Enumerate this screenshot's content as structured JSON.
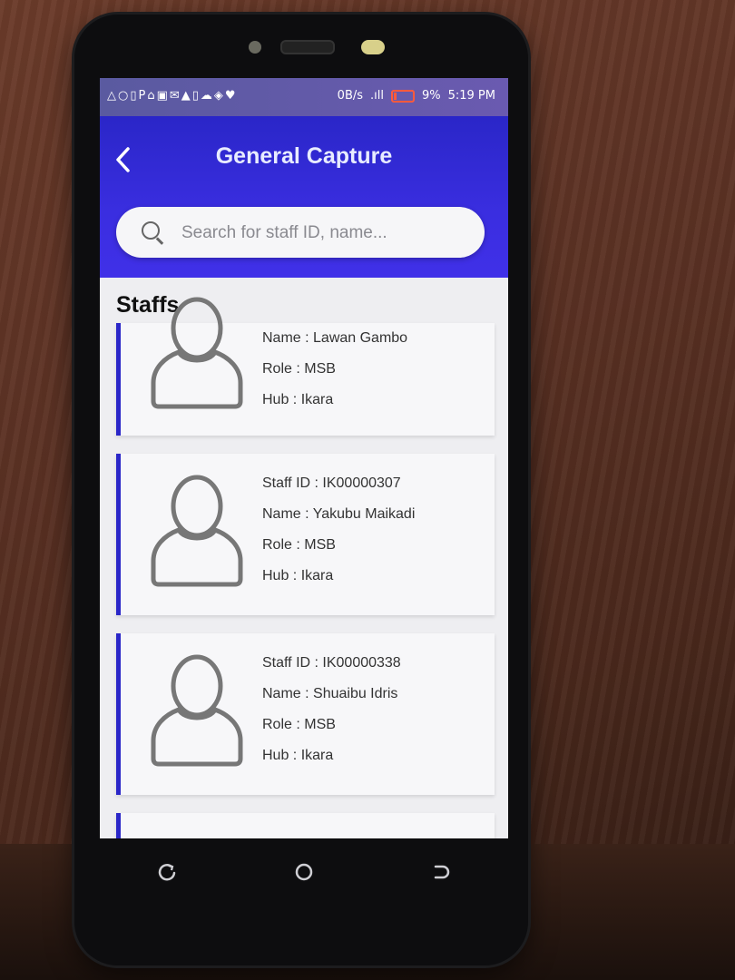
{
  "statusbar": {
    "left_icons": "△○▯P⌂▣✉▲▯☁◈♥",
    "data_rate": "0B/s",
    "signal": ".ıll",
    "battery": "9%",
    "time": "5:19 PM"
  },
  "header": {
    "back_icon": "chevron-left-icon",
    "title": "General Capture"
  },
  "search": {
    "placeholder": "Search for staff ID, name..."
  },
  "section": {
    "title": "Staffs"
  },
  "staffs": [
    {
      "name": "Name : Lawan Gambo",
      "role": "Role : MSB",
      "hub": "Hub : Ikara"
    },
    {
      "staff_id": "Staff ID : IK00000307",
      "name": "Name : Yakubu Maikadi",
      "role": "Role : MSB",
      "hub": "Hub : Ikara"
    },
    {
      "staff_id": "Staff ID : IK00000338",
      "name": "Name : Shuaibu Idris",
      "role": "Role : MSB",
      "hub": "Hub : Ikara"
    }
  ],
  "colors": {
    "accent": "#2a26c8",
    "background": "#eeeef1"
  },
  "navbar": {
    "icons": [
      "recent-apps-icon",
      "home-icon",
      "back-icon"
    ]
  }
}
